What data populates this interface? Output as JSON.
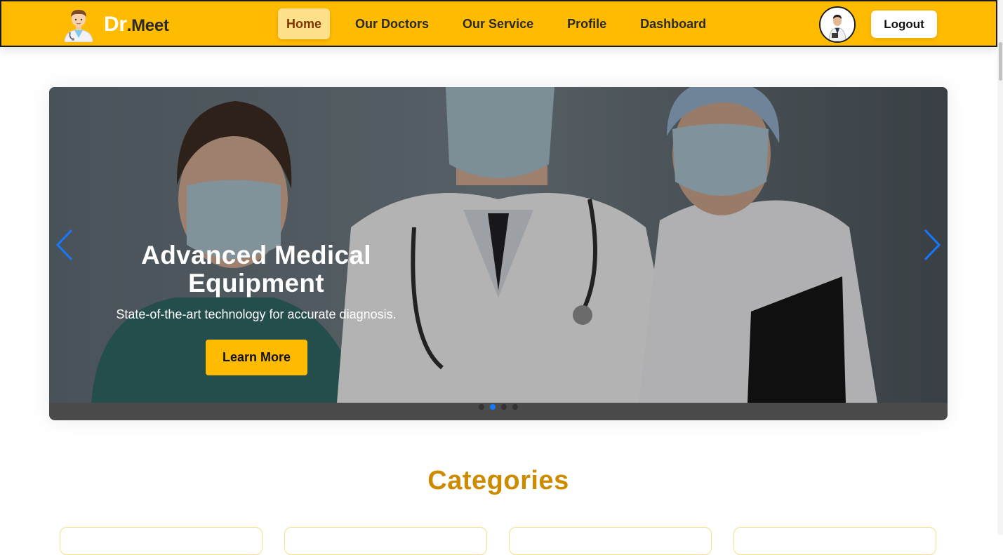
{
  "navbar": {
    "brand_prefix": "Dr",
    "brand_suffix": ".Meet",
    "links": [
      {
        "label": "Home",
        "active": true
      },
      {
        "label": "Our Doctors",
        "active": false
      },
      {
        "label": "Our Service",
        "active": false
      },
      {
        "label": "Profile",
        "active": false
      },
      {
        "label": "Dashboard",
        "active": false
      }
    ],
    "logout_label": "Logout"
  },
  "carousel": {
    "title": "Advanced Medical Equipment",
    "subtitle": "State-of-the-art technology for accurate diagnosis.",
    "button_label": "Learn More",
    "slide_count": 4,
    "active_slide": 2
  },
  "categories": {
    "title": "Categories",
    "card_count": 4
  },
  "colors": {
    "brand": "#ffbb00",
    "accent_title": "#cc8b00",
    "active_dot": "#1677ff"
  },
  "icons": {
    "brand_logo": "doctor-avatar-icon",
    "profile": "user-avatar-icon",
    "prev": "chevron-left-icon",
    "next": "chevron-right-icon"
  }
}
